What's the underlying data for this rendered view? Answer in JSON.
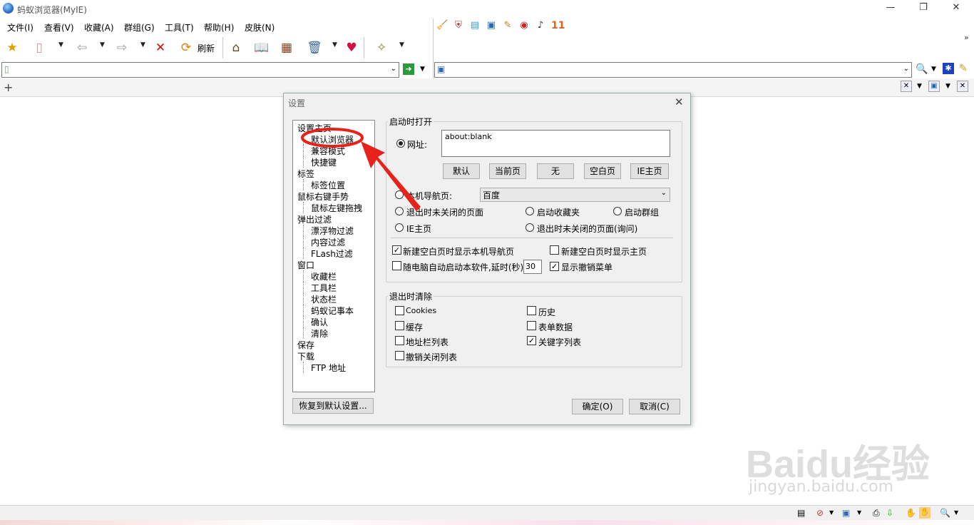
{
  "window": {
    "title": "蚂蚁浏览器(MyIE)",
    "minimize": "—",
    "restore": "❐",
    "close": "✕"
  },
  "menu": [
    "文件(I)",
    "查看(V)",
    "收藏(A)",
    "群组(G)",
    "工具(T)",
    "帮助(H)",
    "皮肤(N)"
  ],
  "counter": "11",
  "toolbar": {
    "refresh": "刷新"
  },
  "watermark": {
    "brand": "Baidu经验",
    "url": "jingyan.baidu.com"
  },
  "dialog": {
    "title": "设置",
    "close": "✕",
    "tree": [
      {
        "label": "设置主页",
        "level": 0
      },
      {
        "label": "默认浏览器",
        "level": 1
      },
      {
        "label": "兼容模式",
        "level": 1
      },
      {
        "label": "快捷键",
        "level": 1
      },
      {
        "label": "标签",
        "level": 0
      },
      {
        "label": "标签位置",
        "level": 1
      },
      {
        "label": "鼠标右键手势",
        "level": 0
      },
      {
        "label": "鼠标左键拖拽",
        "level": 1
      },
      {
        "label": "弹出过滤",
        "level": 0
      },
      {
        "label": "漂浮物过滤",
        "level": 1
      },
      {
        "label": "内容过滤",
        "level": 1
      },
      {
        "label": "FLash过滤",
        "level": 1
      },
      {
        "label": "窗口",
        "level": 0
      },
      {
        "label": "收藏栏",
        "level": 1
      },
      {
        "label": "工具栏",
        "level": 1
      },
      {
        "label": "状态栏",
        "level": 1
      },
      {
        "label": "蚂蚁记事本",
        "level": 1
      },
      {
        "label": "确认",
        "level": 1
      },
      {
        "label": "清除",
        "level": 1
      },
      {
        "label": "保存",
        "level": 0
      },
      {
        "label": "下载",
        "level": 0
      },
      {
        "label": "FTP 地址",
        "level": 1
      }
    ],
    "startup": {
      "legend": "启动时打开",
      "url_label": "网址:",
      "url_value": "about:blank",
      "buttons": [
        "默认",
        "当前页",
        "无",
        "空白页",
        "IE主页"
      ],
      "local_nav_label": "本机导航页:",
      "local_nav_value": "百度",
      "opt_unclosed": "退出时未关闭的页面",
      "opt_favorites": "启动收藏夹",
      "opt_group": "启动群组",
      "opt_ie": "IE主页",
      "opt_unclosed_ask": "退出时未关闭的页面(询问)",
      "cb_new_blank_nav": "新建空白页时显示本机导航页",
      "cb_new_blank_home": "新建空白页时显示主页",
      "cb_autostart": "随电脑自动启动本软件,延时(秒)",
      "delay": "30",
      "cb_undo_menu": "显示撤销菜单"
    },
    "clear": {
      "legend": "退出时清除",
      "cookies": "Cookies",
      "history": "历史",
      "cache": "缓存",
      "form": "表单数据",
      "address": "地址栏列表",
      "keywords": "关键字列表",
      "closed": "撤销关闭列表"
    },
    "restore": "恢复到默认设置...",
    "ok": "确定(O)",
    "cancel": "取消(C)"
  }
}
